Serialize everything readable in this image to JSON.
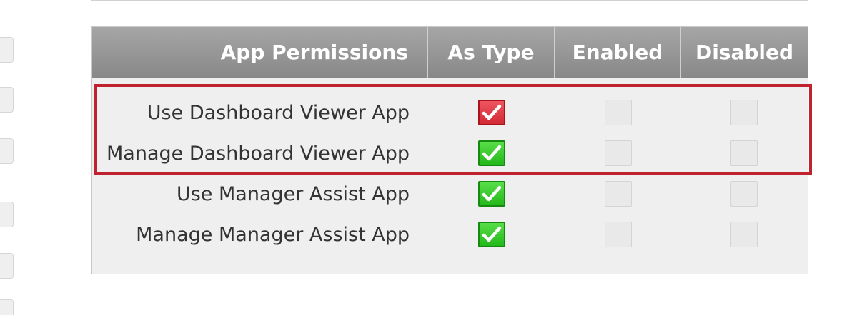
{
  "table": {
    "headers": {
      "name": "App Permissions",
      "as_type": "As Type",
      "enabled": "Enabled",
      "disabled": "Disabled"
    },
    "rows": [
      {
        "label": "Use Dashboard Viewer App",
        "as_type": "checked-red",
        "enabled": "unchecked",
        "disabled": "unchecked"
      },
      {
        "label": "Manage Dashboard Viewer App",
        "as_type": "checked-green",
        "enabled": "unchecked",
        "disabled": "unchecked"
      },
      {
        "label": "Use Manager Assist App",
        "as_type": "checked-green",
        "enabled": "unchecked",
        "disabled": "unchecked"
      },
      {
        "label": "Manage Manager Assist App",
        "as_type": "checked-green",
        "enabled": "unchecked",
        "disabled": "unchecked"
      }
    ]
  },
  "colors": {
    "header_bg": "#999999",
    "table_bg": "#efefef",
    "highlight_border": "#c0222f",
    "check_red": "#d12a35",
    "check_green": "#23b81a"
  },
  "icons": {
    "check": "checkmark-icon"
  }
}
